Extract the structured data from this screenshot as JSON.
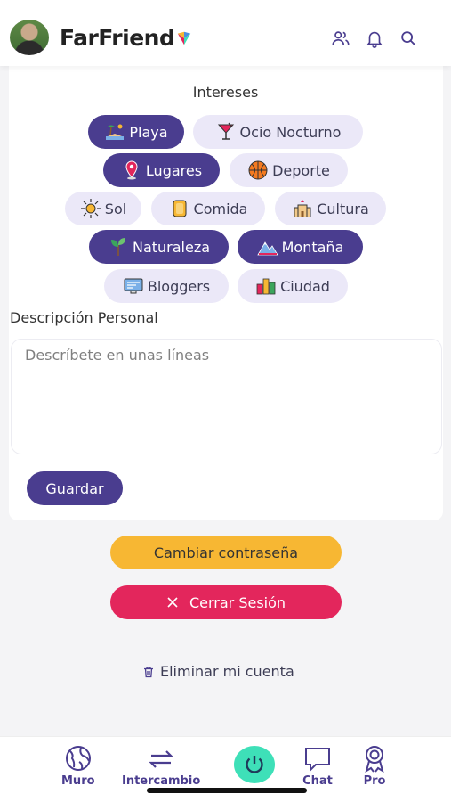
{
  "header": {
    "brand": "FarFriend",
    "icons": [
      "users-icon",
      "bell-icon",
      "search-icon"
    ]
  },
  "interests": {
    "title": "Intereses",
    "chips": [
      {
        "label": "Playa",
        "selected": true,
        "icon": "beach-icon"
      },
      {
        "label": "Ocio Nocturno",
        "selected": false,
        "icon": "cocktail-icon"
      },
      {
        "label": "Lugares",
        "selected": true,
        "icon": "map-pin-icon"
      },
      {
        "label": "Deporte",
        "selected": false,
        "icon": "basketball-icon"
      },
      {
        "label": "Sol",
        "selected": false,
        "icon": "sun-icon"
      },
      {
        "label": "Comida",
        "selected": false,
        "icon": "food-icon"
      },
      {
        "label": "Cultura",
        "selected": false,
        "icon": "castle-icon"
      },
      {
        "label": "Naturaleza",
        "selected": true,
        "icon": "plant-icon"
      },
      {
        "label": "Montaña",
        "selected": true,
        "icon": "mountain-icon"
      },
      {
        "label": "Bloggers",
        "selected": false,
        "icon": "blog-icon"
      },
      {
        "label": "Ciudad",
        "selected": false,
        "icon": "city-icon"
      }
    ]
  },
  "description": {
    "label": "Descripción Personal",
    "placeholder": "Descríbete en unas líneas",
    "value": ""
  },
  "buttons": {
    "save": "Guardar",
    "change_password": "Cambiar contraseña",
    "logout": "Cerrar Sesión",
    "delete_account": "Eliminar mi cuenta"
  },
  "tabbar": {
    "items": [
      {
        "label": "Muro",
        "icon": "globe-icon"
      },
      {
        "label": "Intercambio",
        "icon": "exchange-icon"
      },
      {
        "label": "",
        "icon": "power-icon"
      },
      {
        "label": "Chat",
        "icon": "chat-icon"
      },
      {
        "label": "Pro",
        "icon": "badge-icon"
      }
    ]
  },
  "colors": {
    "primary": "#4a3d8f",
    "chip_off": "#ebe8f8",
    "password": "#f7b733",
    "logout": "#e3265c",
    "power": "#3ee0b8"
  }
}
